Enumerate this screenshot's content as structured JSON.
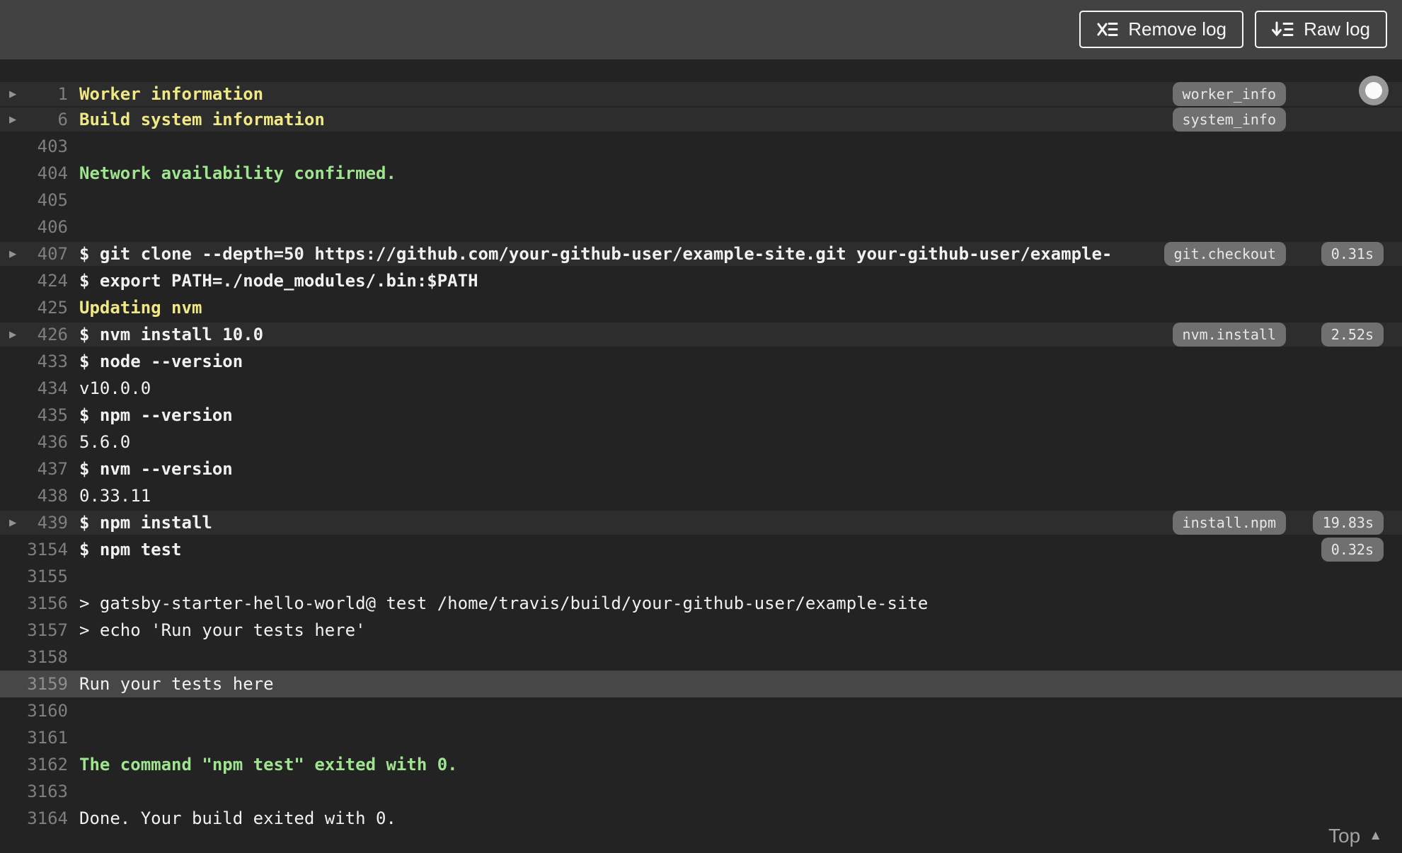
{
  "toolbar": {
    "remove_log_label": "Remove log",
    "raw_log_label": "Raw log"
  },
  "footer": {
    "top_label": "Top"
  },
  "colors": {
    "topbar_bg": "#424242",
    "log_bg": "#232323",
    "fold_row_bg": "#2d2d2d",
    "selected_row_bg": "#474747",
    "text": "#f1f1f1",
    "line_number": "#7f7f7f",
    "yellow": "#f0e884",
    "green": "#9fe48f",
    "badge_bg": "#707070",
    "badge_text": "#e7e7e7"
  },
  "log": {
    "rows": [
      {
        "n": "1",
        "text": "Worker information",
        "kind": "yellow",
        "fold": true,
        "tag": "worker_info",
        "dur": null,
        "selected": false
      },
      {
        "n": "6",
        "text": "Build system information",
        "kind": "yellow",
        "fold": true,
        "tag": "system_info",
        "dur": null,
        "selected": false
      },
      {
        "n": "403",
        "text": "",
        "kind": "empty",
        "fold": false,
        "tag": null,
        "dur": null,
        "selected": false
      },
      {
        "n": "404",
        "text": "Network availability confirmed.",
        "kind": "green",
        "fold": false,
        "tag": null,
        "dur": null,
        "selected": false
      },
      {
        "n": "405",
        "text": "",
        "kind": "empty",
        "fold": false,
        "tag": null,
        "dur": null,
        "selected": false
      },
      {
        "n": "406",
        "text": "",
        "kind": "empty",
        "fold": false,
        "tag": null,
        "dur": null,
        "selected": false
      },
      {
        "n": "407",
        "text": "$ git clone --depth=50 https://github.com/your-github-user/example-site.git your-github-user/example-",
        "kind": "command",
        "fold": true,
        "tag": "git.checkout",
        "dur": "0.31s",
        "selected": false
      },
      {
        "n": "424",
        "text": "$ export PATH=./node_modules/.bin:$PATH",
        "kind": "command",
        "fold": false,
        "tag": null,
        "dur": null,
        "selected": false
      },
      {
        "n": "425",
        "text": "Updating nvm",
        "kind": "yellow",
        "fold": false,
        "tag": null,
        "dur": null,
        "selected": false
      },
      {
        "n": "426",
        "text": "$ nvm install 10.0",
        "kind": "command",
        "fold": true,
        "tag": "nvm.install",
        "dur": "2.52s",
        "selected": false
      },
      {
        "n": "433",
        "text": "$ node --version",
        "kind": "command",
        "fold": false,
        "tag": null,
        "dur": null,
        "selected": false
      },
      {
        "n": "434",
        "text": "v10.0.0",
        "kind": "output",
        "fold": false,
        "tag": null,
        "dur": null,
        "selected": false
      },
      {
        "n": "435",
        "text": "$ npm --version",
        "kind": "command",
        "fold": false,
        "tag": null,
        "dur": null,
        "selected": false
      },
      {
        "n": "436",
        "text": "5.6.0",
        "kind": "output",
        "fold": false,
        "tag": null,
        "dur": null,
        "selected": false
      },
      {
        "n": "437",
        "text": "$ nvm --version",
        "kind": "command",
        "fold": false,
        "tag": null,
        "dur": null,
        "selected": false
      },
      {
        "n": "438",
        "text": "0.33.11",
        "kind": "output",
        "fold": false,
        "tag": null,
        "dur": null,
        "selected": false
      },
      {
        "n": "439",
        "text": "$ npm install",
        "kind": "command",
        "fold": true,
        "tag": "install.npm",
        "dur": "19.83s",
        "selected": false
      },
      {
        "n": "3154",
        "text": "$ npm test",
        "kind": "command",
        "fold": false,
        "tag": null,
        "dur": "0.32s",
        "selected": false
      },
      {
        "n": "3155",
        "text": "",
        "kind": "empty",
        "fold": false,
        "tag": null,
        "dur": null,
        "selected": false
      },
      {
        "n": "3156",
        "text": "> gatsby-starter-hello-world@ test /home/travis/build/your-github-user/example-site",
        "kind": "output",
        "fold": false,
        "tag": null,
        "dur": null,
        "selected": false
      },
      {
        "n": "3157",
        "text": "> echo 'Run your tests here'",
        "kind": "output",
        "fold": false,
        "tag": null,
        "dur": null,
        "selected": false
      },
      {
        "n": "3158",
        "text": "",
        "kind": "empty",
        "fold": false,
        "tag": null,
        "dur": null,
        "selected": false
      },
      {
        "n": "3159",
        "text": "Run your tests here",
        "kind": "output",
        "fold": false,
        "tag": null,
        "dur": null,
        "selected": true
      },
      {
        "n": "3160",
        "text": "",
        "kind": "empty",
        "fold": false,
        "tag": null,
        "dur": null,
        "selected": false
      },
      {
        "n": "3161",
        "text": "",
        "kind": "empty",
        "fold": false,
        "tag": null,
        "dur": null,
        "selected": false
      },
      {
        "n": "3162",
        "text": "The command \"npm test\" exited with 0.",
        "kind": "green",
        "fold": false,
        "tag": null,
        "dur": null,
        "selected": false
      },
      {
        "n": "3163",
        "text": "",
        "kind": "empty",
        "fold": false,
        "tag": null,
        "dur": null,
        "selected": false
      },
      {
        "n": "3164",
        "text": "Done. Your build exited with 0.",
        "kind": "output",
        "fold": false,
        "tag": null,
        "dur": null,
        "selected": false
      }
    ]
  }
}
